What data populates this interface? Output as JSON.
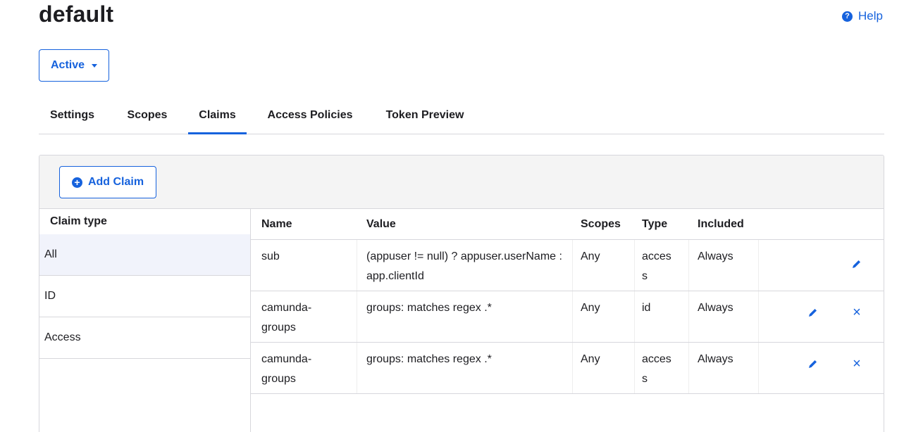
{
  "page": {
    "title": "default"
  },
  "help": {
    "label": "Help",
    "icon": "question-circle-icon"
  },
  "status": {
    "selected": "Active",
    "icon": "caret-down-icon"
  },
  "tabs": [
    {
      "label": "Settings",
      "active": false
    },
    {
      "label": "Scopes",
      "active": false
    },
    {
      "label": "Claims",
      "active": true
    },
    {
      "label": "Access Policies",
      "active": false
    },
    {
      "label": "Token Preview",
      "active": false
    }
  ],
  "toolbar": {
    "add_claim_label": "Add Claim",
    "add_icon": "plus-circle-icon"
  },
  "claim_types": {
    "header": "Claim type",
    "items": [
      {
        "label": "All",
        "selected": true
      },
      {
        "label": "ID",
        "selected": false
      },
      {
        "label": "Access",
        "selected": false
      }
    ]
  },
  "table": {
    "columns": [
      "Name",
      "Value",
      "Scopes",
      "Type",
      "Included"
    ],
    "rows": [
      {
        "name": "sub",
        "value": "(appuser != null) ? appuser.userName : app.clientId",
        "scopes": "Any",
        "type": "access",
        "included": "Always",
        "editable": true,
        "deletable": false
      },
      {
        "name": "camunda-groups",
        "value": "groups: matches regex .*",
        "scopes": "Any",
        "type": "id",
        "included": "Always",
        "editable": true,
        "deletable": true
      },
      {
        "name": "camunda-groups",
        "value": "groups: matches regex .*",
        "scopes": "Any",
        "type": "access",
        "included": "Always",
        "editable": true,
        "deletable": true
      }
    ]
  },
  "colors": {
    "accent": "#1662dd",
    "border": "#d7d7dc",
    "selected_bg": "#f1f3fb",
    "toolbar_bg": "#f4f4f4"
  }
}
